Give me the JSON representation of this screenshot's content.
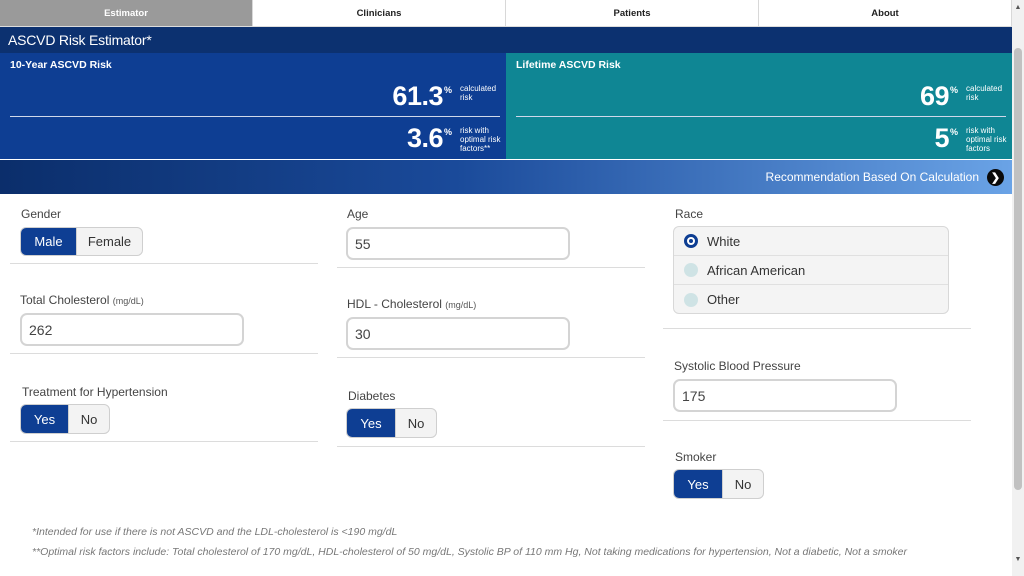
{
  "nav": [
    {
      "label": "Estimator"
    },
    {
      "label": "Clinicians"
    },
    {
      "label": "Patients"
    },
    {
      "label": "About"
    }
  ],
  "title": "ASCVD Risk Estimator*",
  "ten_year": {
    "title": "10-Year ASCVD Risk",
    "calculated_value": "61.3",
    "calculated_desc": "calculated risk",
    "optimal_value": "3.6",
    "optimal_desc": "risk with optimal risk factors**",
    "pct": "%"
  },
  "lifetime": {
    "title": "Lifetime ASCVD Risk",
    "calculated_value": "69",
    "calculated_desc": "calculated risk",
    "optimal_value": "5",
    "optimal_desc": "risk with optimal risk factors",
    "pct": "%"
  },
  "recommendation": {
    "label": "Recommendation Based On Calculation",
    "icon": "chevron-right-icon"
  },
  "gender": {
    "label": "Gender",
    "options": [
      "Male",
      "Female"
    ],
    "selected": "Male"
  },
  "age": {
    "label": "Age",
    "value": "55"
  },
  "race": {
    "label": "Race",
    "options": [
      "White",
      "African American",
      "Other"
    ],
    "selected": "White"
  },
  "total_chol": {
    "label": "Total Cholesterol",
    "unit": "(mg/dL)",
    "value": "262"
  },
  "hdl": {
    "label": "HDL - Cholesterol",
    "unit": "(mg/dL)",
    "value": "30"
  },
  "sbp": {
    "label": "Systolic Blood Pressure",
    "value": "175"
  },
  "hypertension": {
    "label": "Treatment for Hypertension",
    "options": [
      "Yes",
      "No"
    ],
    "selected": "Yes"
  },
  "diabetes": {
    "label": "Diabetes",
    "options": [
      "Yes",
      "No"
    ],
    "selected": "Yes"
  },
  "smoker": {
    "label": "Smoker",
    "options": [
      "Yes",
      "No"
    ],
    "selected": "Yes"
  },
  "footnotes": [
    "*Intended for use if there is not ASCVD and the LDL-cholesterol is <190 mg/dL",
    "**Optimal risk factors include: Total cholesterol of 170 mg/dL, HDL-cholesterol of 50 mg/dL, Systolic BP of 110 mm Hg, Not taking medications for hypertension, Not a diabetic, Not a smoker"
  ],
  "colors": {
    "primary": "#0e3e93",
    "teal": "#0f8694",
    "header": "#0c3170"
  }
}
